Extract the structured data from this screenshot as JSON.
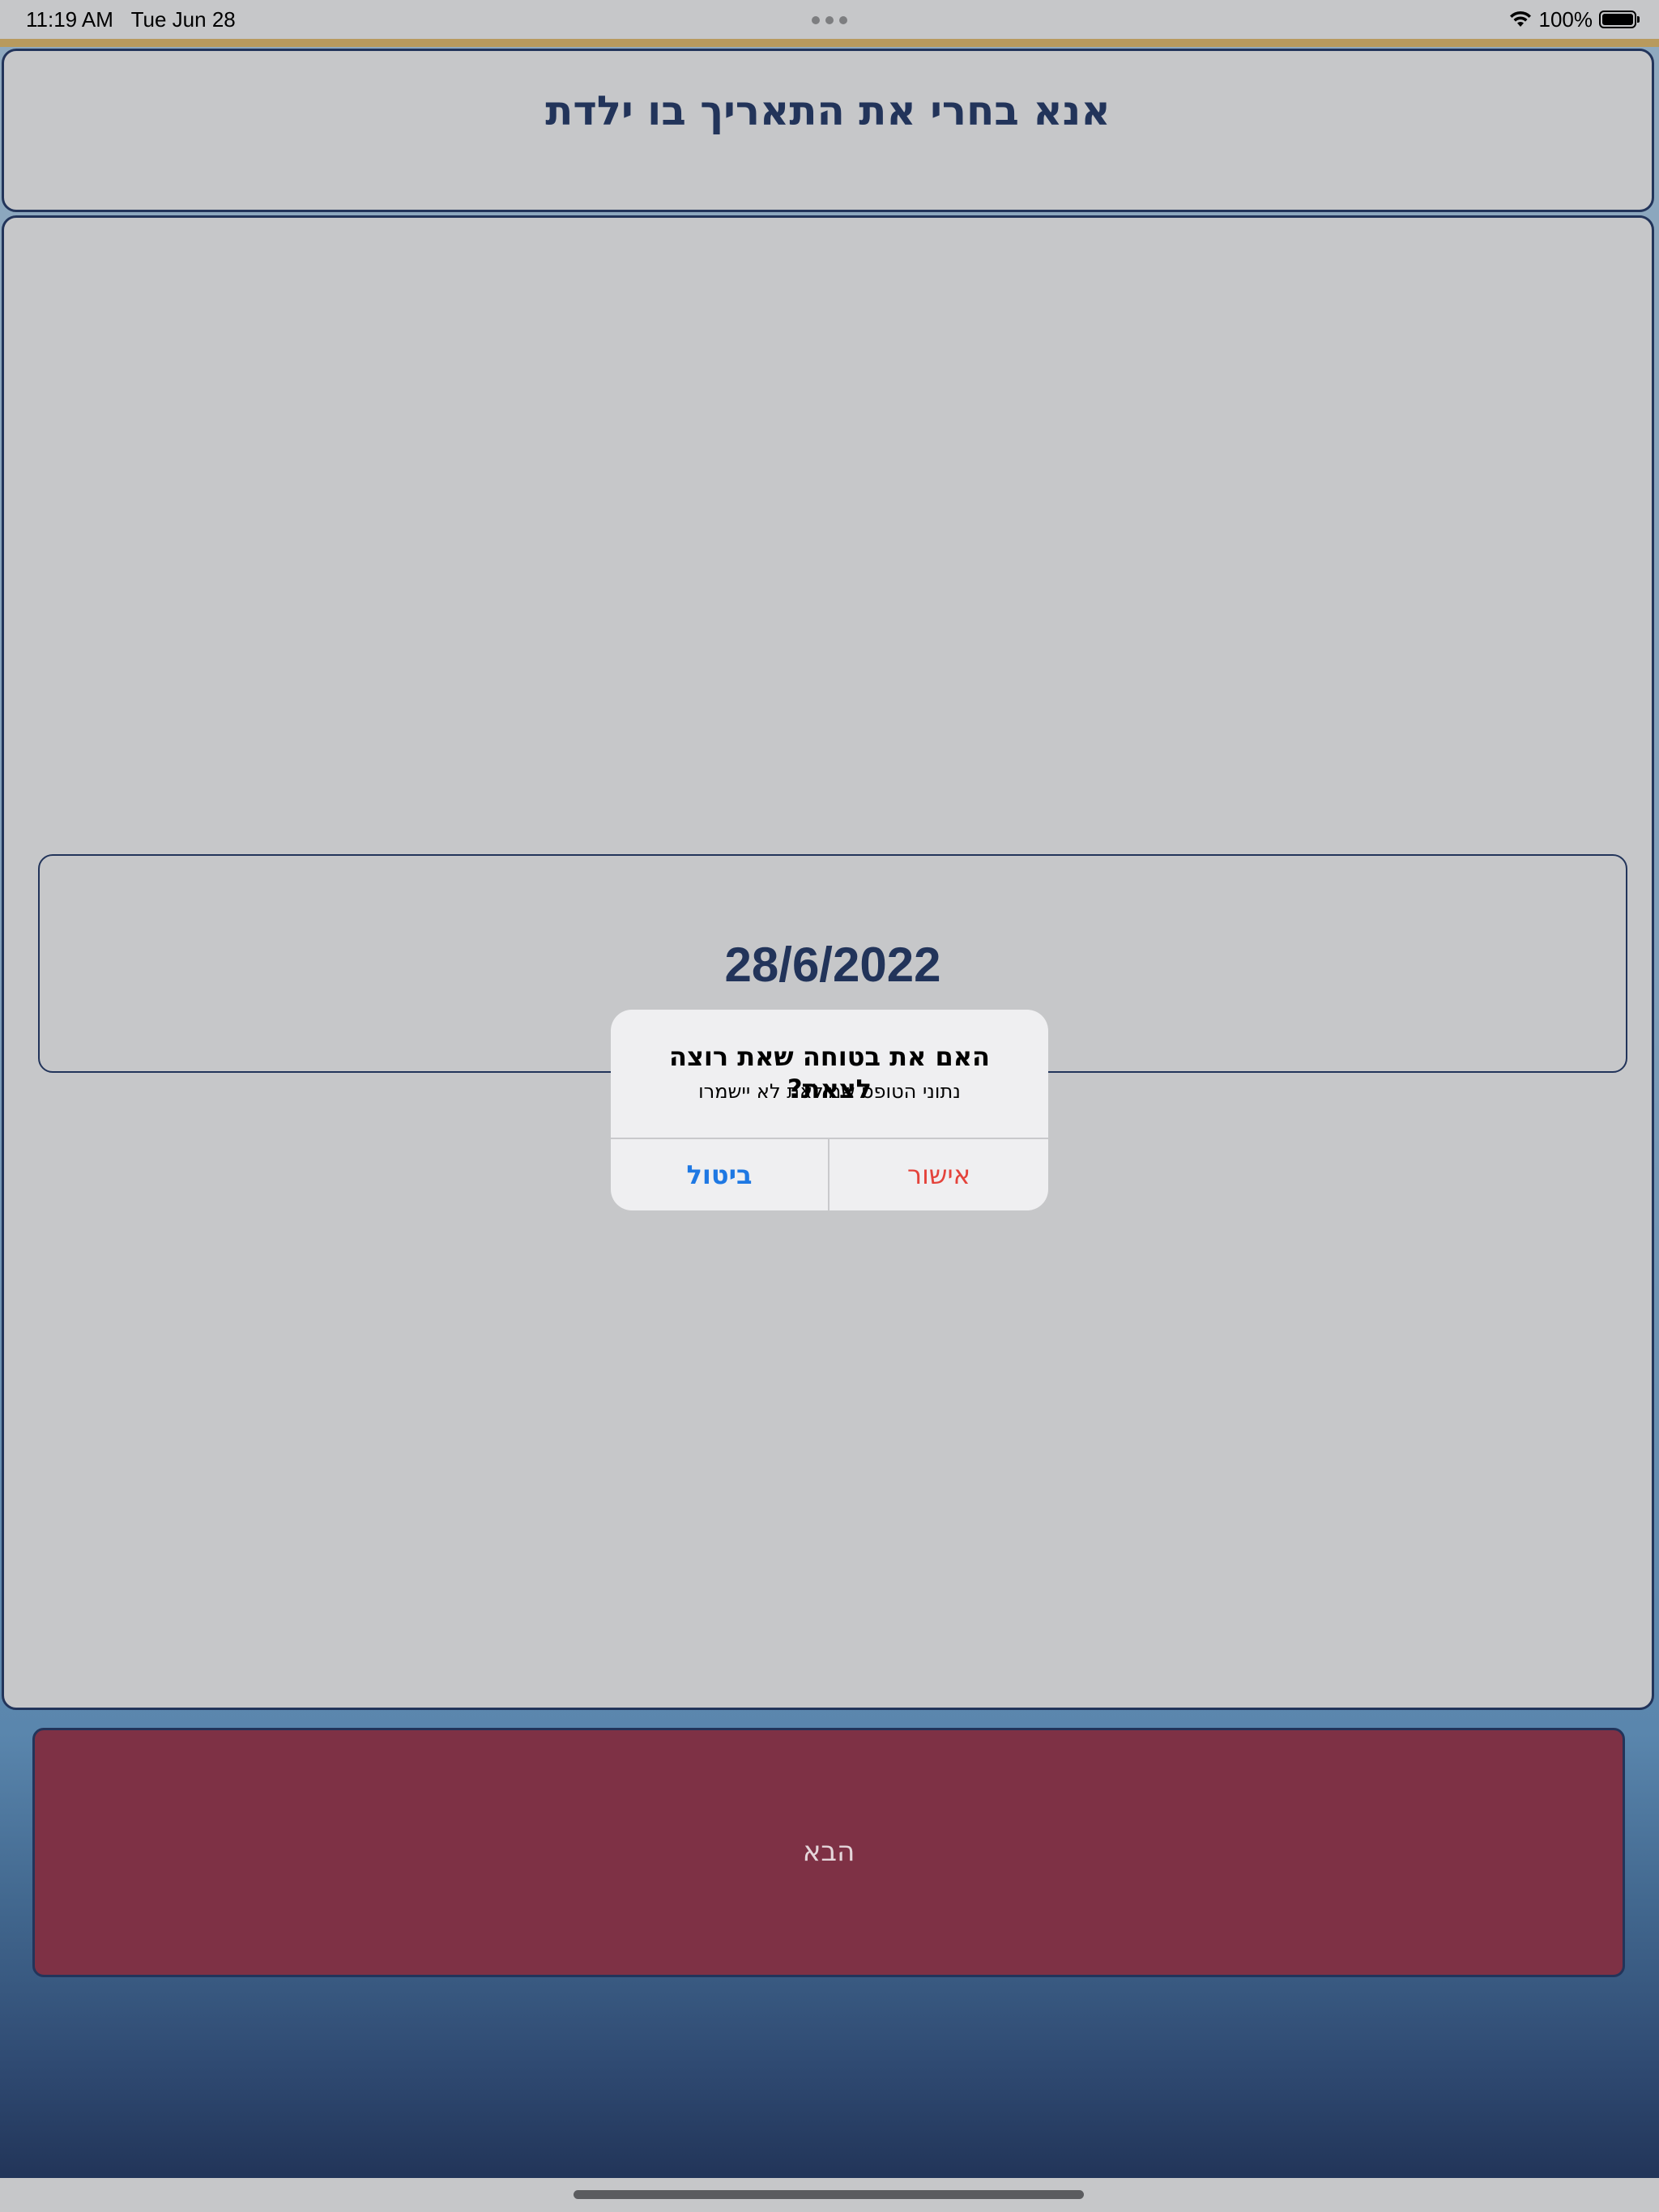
{
  "status_bar": {
    "time": "11:19 AM",
    "date": "Tue Jun 28",
    "battery_percent": "100%",
    "icons": {
      "wifi": "wifi-icon",
      "battery": "battery-icon",
      "multitask": "more-dots-icon"
    }
  },
  "header": {
    "title": "אנא בחרי את התאריך בו ילדת"
  },
  "date_picker": {
    "value": "28/6/2022"
  },
  "next_button": {
    "label": "הבא"
  },
  "alert": {
    "title": "האם את בטוחה שאת רוצה לצאת?",
    "message": "נתוני הטופס שמילאת לא יישמרו",
    "cancel_label": "ביטול",
    "confirm_label": "אישור"
  },
  "colors": {
    "primary_navy": "#22345a",
    "next_button": "#7e3145",
    "panel_bg": "#c6c7c9",
    "alert_cancel": "#1e78e3",
    "alert_confirm": "#e4433b"
  }
}
